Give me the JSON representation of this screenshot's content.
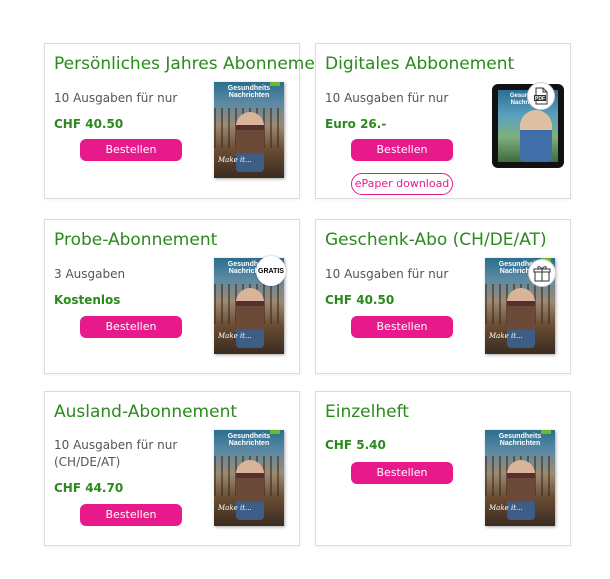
{
  "accent_color": "#e8198b",
  "title_color": "#2a8a1c",
  "cover": {
    "masthead": "Gesundheits Nachrichten",
    "script": "Make it..."
  },
  "cards": [
    {
      "title": "Persönliches Jahres Abonnement",
      "desc": "10 Ausgaben für nur",
      "price": "CHF 40.50",
      "button": "Bestellen"
    },
    {
      "title": "Digitales Abbonement",
      "desc": "10 Ausgaben für nur",
      "price": "Euro 26.-",
      "button": "Bestellen",
      "secondary_button": "ePaper download",
      "badge_text": "PDF",
      "badge_icon": "pdf-icon"
    },
    {
      "title": "Probe-Abonnement",
      "desc": "3 Ausgaben",
      "price": "Kostenlos",
      "button": "Bestellen",
      "badge_text": "GRATIS"
    },
    {
      "title": "Geschenk-Abo (CH/DE/AT)",
      "desc": "10 Ausgaben für nur",
      "price": "CHF 40.50",
      "button": "Bestellen",
      "badge_icon": "gift-icon"
    },
    {
      "title": "Ausland-Abonnement",
      "desc_line1": "10 Ausgaben für nur",
      "desc_line2": "(CH/DE/AT)",
      "price": "CHF 44.70",
      "button": "Bestellen"
    },
    {
      "title": "Einzelheft",
      "price": "CHF 5.40",
      "button": "Bestellen"
    }
  ]
}
